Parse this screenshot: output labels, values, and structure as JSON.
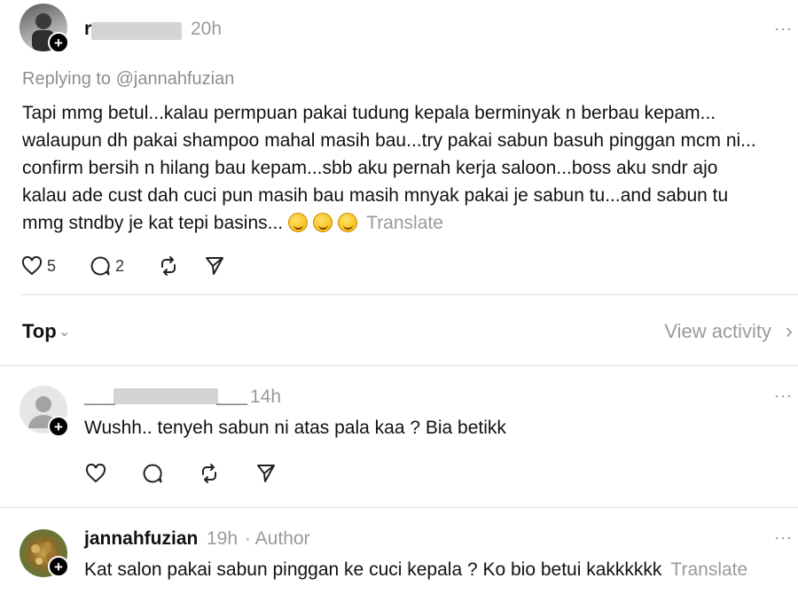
{
  "post": {
    "username": "r",
    "time": "20h",
    "more": "···",
    "replying_to": "Replying to @jannahfuzian",
    "lines": [
      "Tapi mmg betul...kalau permpuan pakai tudung kepala berminyak n berbau kepam...",
      "walaupun dh pakai shampoo mahal masih bau...try pakai sabun basuh pinggan mcm ni...",
      "confirm bersih n hilang bau kepam...sbb aku pernah kerja saloon...boss aku sndr ajo",
      "kalau ade cust dah cuci pun masih bau masih mnyak pakai je sabun tu...and sabun tu",
      "mmg stndby je kat tepi basins..."
    ],
    "translate": "Translate",
    "likes": "5",
    "replies": "2",
    "icons": [
      "heart-icon",
      "comment-icon",
      "repost-icon",
      "share-icon",
      "emoji-grin-icon"
    ]
  },
  "sort": {
    "label": "Top",
    "chevron": "⌄",
    "view_activity": "View activity",
    "view_chevron": "›"
  },
  "comments": [
    {
      "username": "___",
      "username_tail": "___",
      "time": "14h",
      "text": "Wushh.. tenyeh sabun ni atas pala kaa ? Bia betikk",
      "more": "···"
    },
    {
      "username": "jannahfuzian",
      "time": "19h",
      "author_tag": "· Author",
      "text": "Kat salon pakai sabun pinggan ke cuci kepala ? Ko bio betui kakkkkkk",
      "translate": "Translate",
      "more": "···"
    }
  ],
  "colors": {
    "text": "#111111",
    "muted": "#9a9a9a",
    "divider": "#dcdcdc"
  }
}
